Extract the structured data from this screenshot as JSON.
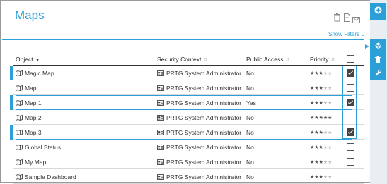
{
  "page": {
    "title": "Maps",
    "show_filters": "Show Filters"
  },
  "header_actions": [
    {
      "name": "delete-icon"
    },
    {
      "name": "export-document-icon"
    },
    {
      "name": "email-icon"
    }
  ],
  "table": {
    "columns": {
      "object": "Object",
      "security_context": "Security Context",
      "public_access": "Public Access",
      "priority": "Priority"
    },
    "rows": [
      {
        "object": "Magic Map",
        "security_context": "PRTG System Administrator",
        "public_access": "No",
        "priority": 3,
        "checked": true,
        "highlighted": true
      },
      {
        "object": "Map",
        "security_context": "PRTG System Administrator",
        "public_access": "No",
        "priority": 3,
        "checked": false,
        "highlighted": false
      },
      {
        "object": "Map 1",
        "security_context": "PRTG System Administrator",
        "public_access": "Yes",
        "priority": 3,
        "checked": true,
        "highlighted": true
      },
      {
        "object": "Map 2",
        "security_context": "PRTG System Administrator",
        "public_access": "No",
        "priority": 5,
        "checked": false,
        "highlighted": false
      },
      {
        "object": "Map 3",
        "security_context": "PRTG System Administrator",
        "public_access": "No",
        "priority": 3,
        "checked": true,
        "highlighted": true
      },
      {
        "object": "Global Status",
        "security_context": "PRTG System Administrator",
        "public_access": "No",
        "priority": 3,
        "checked": false,
        "highlighted": false
      },
      {
        "object": "My Map",
        "security_context": "PRTG System Administrator",
        "public_access": "No",
        "priority": 3,
        "checked": false,
        "highlighted": false
      },
      {
        "object": "Sample Dashboard",
        "security_context": "PRTG System Administrator",
        "public_access": "No",
        "priority": 3,
        "checked": false,
        "highlighted": false
      }
    ]
  },
  "side_rail": [
    {
      "name": "add-icon"
    },
    {
      "name": "layers-icon"
    },
    {
      "name": "trash-icon"
    },
    {
      "name": "wrench-icon"
    }
  ],
  "colors": {
    "accent": "#2a9fd8",
    "text": "#333333",
    "rail_background": "#e9eef2"
  }
}
